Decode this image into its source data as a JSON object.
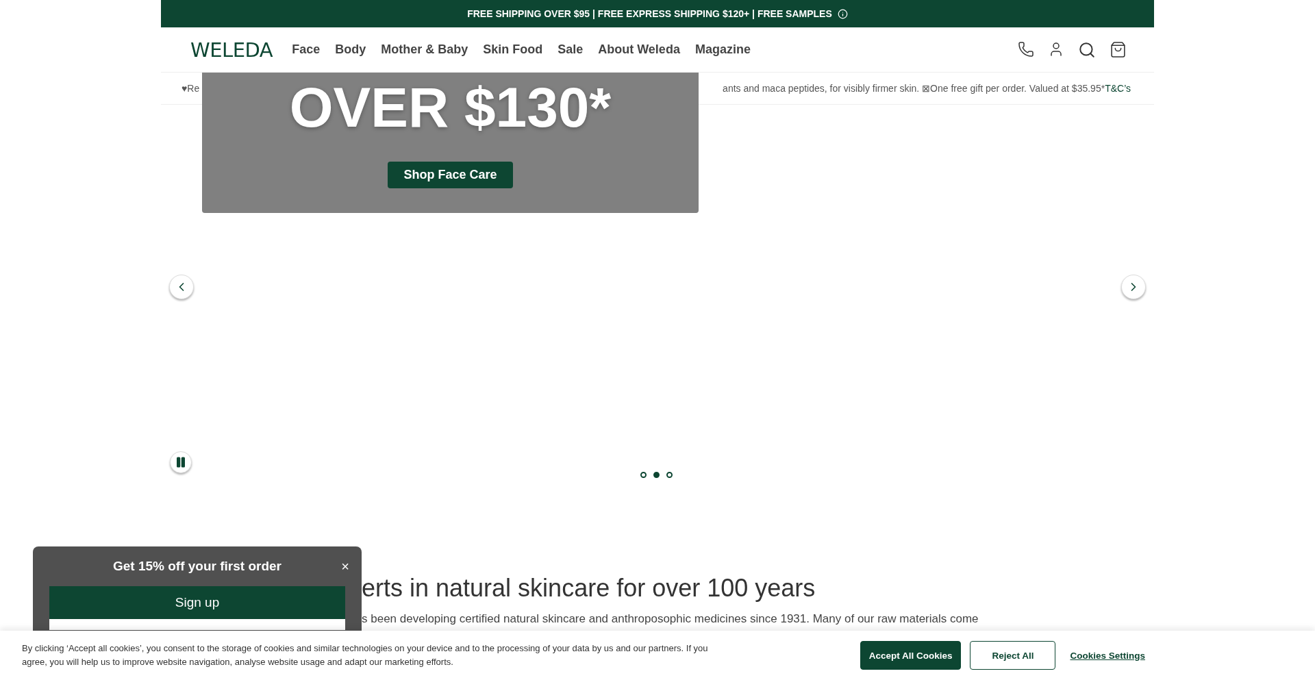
{
  "top_bar": {
    "text": "FREE SHIPPING OVER $95 | FREE EXPRESS SHIPPING $120+ | FREE SAMPLES"
  },
  "header": {
    "logo": "WELEDA",
    "nav": [
      "Face",
      "Body",
      "Mother & Baby",
      "Skin Food",
      "Sale",
      "About Weleda",
      "Magazine"
    ]
  },
  "promo": {
    "start": "♥Re",
    "end": "ants and maca peptides, for visibly firmer skin. ⊠One free gift per order. Valued at $35.95*",
    "link": "T&C’s"
  },
  "hero": {
    "headline": "OVER $130*",
    "button": "Shop Face Care",
    "playing": true,
    "slides": [
      {
        "selected": false
      },
      {
        "selected": true
      },
      {
        "selected": false
      }
    ]
  },
  "intro": {
    "heading": "erts in natural skincare for over 100 years",
    "text": "s been developing certified natural skincare and anthroposophic medicines since 1931. Many of our raw materials come"
  },
  "signup_popup": {
    "title": "Get 15% off your first order",
    "close": "×",
    "button": "Sign up"
  },
  "cookie_banner": {
    "text": "By clicking ‘Accept all cookies’, you consent to the storage of cookies and similar technologies on your device and to the processing of your data by us and our partners. If you agree, you will help us to improve website navigation, analyse website usage and adapt our marketing efforts.",
    "accept": "Accept All Cookies",
    "reject": "Reject All",
    "settings": "Cookies Settings"
  }
}
